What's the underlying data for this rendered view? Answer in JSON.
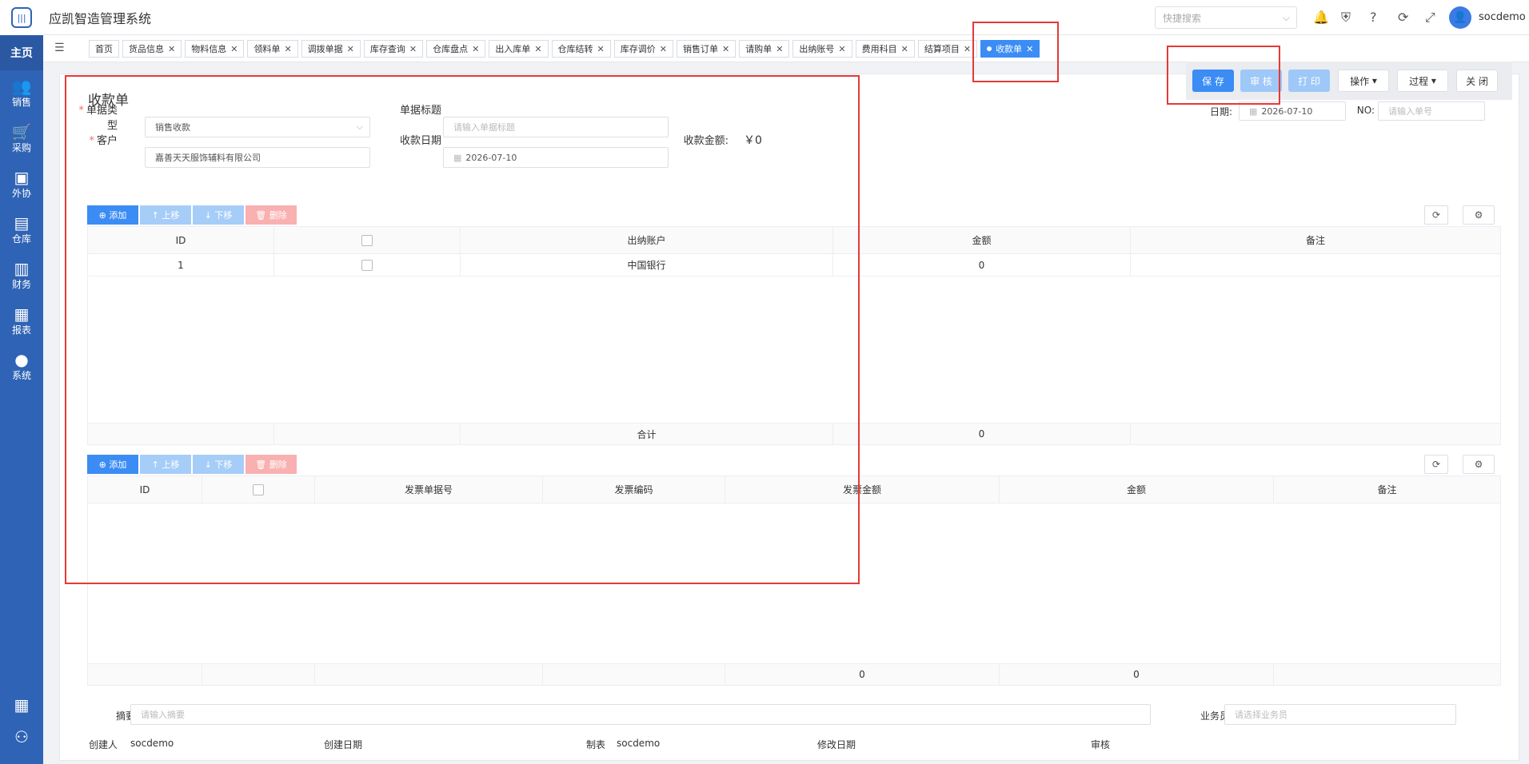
{
  "app": {
    "title": "应凯智造管理系统",
    "logo": "barcode-logo"
  },
  "sidebar": {
    "home": "主页",
    "items": [
      {
        "label": "销售",
        "icon": "users-icon"
      },
      {
        "label": "采购",
        "icon": "cart-icon"
      },
      {
        "label": "外协",
        "icon": "outsource-icon"
      },
      {
        "label": "仓库",
        "icon": "warehouse-icon"
      },
      {
        "label": "财务",
        "icon": "finance-icon"
      },
      {
        "label": "报表",
        "icon": "chart-icon"
      },
      {
        "label": "系统",
        "icon": "person-icon"
      }
    ]
  },
  "header": {
    "search_placeholder": "快捷搜索",
    "username": "socdemo"
  },
  "tabs": [
    {
      "label": "首页",
      "closable": false
    },
    {
      "label": "货品信息",
      "closable": true
    },
    {
      "label": "物料信息",
      "closable": true
    },
    {
      "label": "领料单",
      "closable": true
    },
    {
      "label": "调拨单据",
      "closable": true
    },
    {
      "label": "库存查询",
      "closable": true
    },
    {
      "label": "仓库盘点",
      "closable": true
    },
    {
      "label": "出入库单",
      "closable": true
    },
    {
      "label": "仓库结转",
      "closable": true
    },
    {
      "label": "库存调价",
      "closable": true
    },
    {
      "label": "销售订单",
      "closable": true
    },
    {
      "label": "请购单",
      "closable": true
    },
    {
      "label": "出纳账号",
      "closable": true
    },
    {
      "label": "费用科目",
      "closable": true
    },
    {
      "label": "结算项目",
      "closable": true
    },
    {
      "label": "收款单",
      "closable": true,
      "active": true
    }
  ],
  "toolbar": {
    "save": "保 存",
    "audit": "审 核",
    "print": "打 印",
    "operate": "操作",
    "process": "过程",
    "close": "关 闭"
  },
  "form": {
    "title": "收款单",
    "doc_type_label": "单据类型",
    "doc_type_value": "销售收款",
    "doc_title_label": "单据标题",
    "doc_title_placeholder": "请输入单据标题",
    "customer_label": "客户",
    "customer_value": "嘉善天天服饰辅料有限公司",
    "receipt_date_label": "收款日期",
    "receipt_date_value": "2026-07-10",
    "amount_label": "收款金额:",
    "amount_value": "￥0",
    "date_label": "日期:",
    "date_value": "2026-07-10",
    "no_label": "NO:",
    "no_placeholder": "请输入单号"
  },
  "grid_buttons": {
    "add": "⊕ 添加",
    "up": "↑ 上移",
    "down": "↓ 下移",
    "delete": "🗑 删除"
  },
  "grid1": {
    "columns": [
      "ID",
      "",
      "出纳账户",
      "金额",
      "备注"
    ],
    "rows": [
      {
        "id": "1",
        "account": "中国银行",
        "amount": "0",
        "note": ""
      }
    ],
    "sum_label": "合计",
    "sum_amount": "0"
  },
  "grid2": {
    "columns": [
      "ID",
      "",
      "发票单据号",
      "发票编码",
      "发票金额",
      "金额",
      "备注"
    ],
    "sum_invoice": "0",
    "sum_amount": "0"
  },
  "footer": {
    "summary_label": "摘要",
    "summary_placeholder": "请输入摘要",
    "salesman_label": "业务员",
    "salesman_placeholder": "请选择业务员",
    "creator_label": "创建人",
    "creator_value": "socdemo",
    "created_label": "创建日期",
    "maker_label": "制表",
    "maker_value": "socdemo",
    "modified_label": "修改日期",
    "auditor_label": "审核"
  }
}
